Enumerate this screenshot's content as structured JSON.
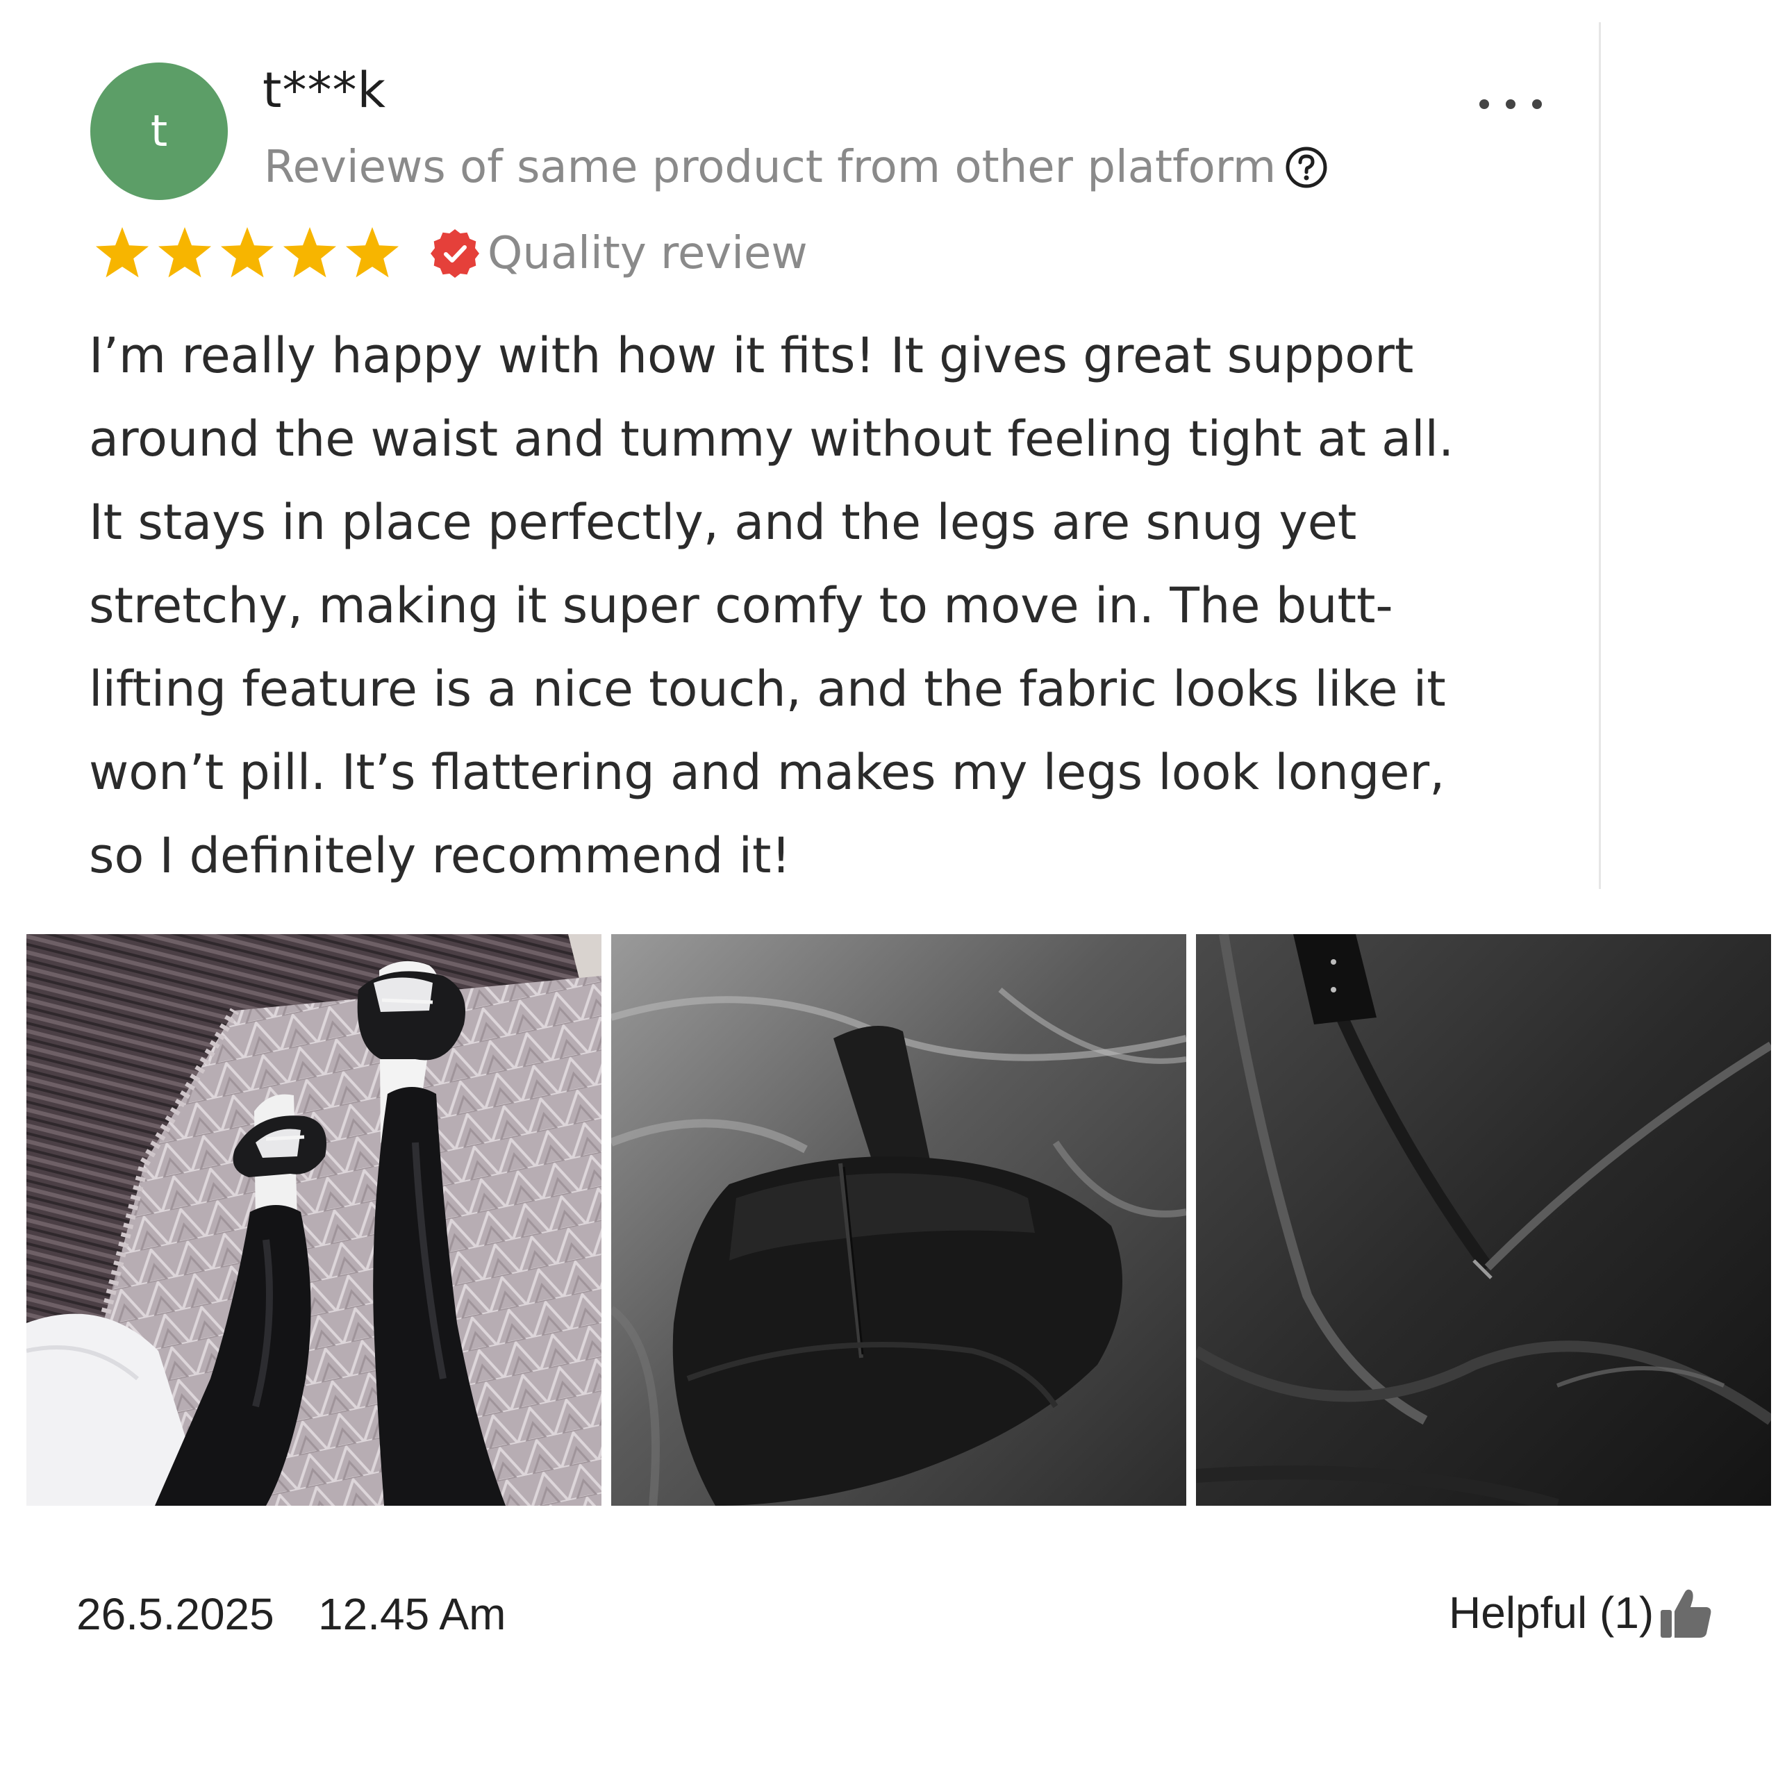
{
  "review": {
    "avatar_initial": "t",
    "username": "t***k",
    "source_note": "Reviews of same product from other platform",
    "rating": 5,
    "rating_max": 5,
    "quality_label": "Quality review",
    "body_lines": [
      "I’m really happy with how it fits! It gives great support",
      "around the waist and tummy without feeling tight at all.",
      "It stays in place perfectly, and the legs are snug yet",
      "stretchy, making it super comfy to move in. The butt-",
      "lifting feature is a nice touch, and the fabric looks like it",
      "won’t pill. It’s flattering and makes my legs look longer,",
      "so I definitely recommend it!"
    ],
    "date": "26.5.2025",
    "time": "12.45 Am",
    "helpful_label": "Helpful (1)"
  },
  "icons": {
    "more": "more-horizontal-icon",
    "help": "question-circle-icon",
    "star": "star-icon",
    "badge": "verified-badge-icon",
    "helpful": "thumbs-up-icon"
  },
  "colors": {
    "avatar_bg": "#5c9e67",
    "star": "#f7b500",
    "badge": "#e5403a",
    "muted_text": "#8a8a8a",
    "body_text": "#2b2b2b",
    "thumb": "#6b6b6b"
  }
}
